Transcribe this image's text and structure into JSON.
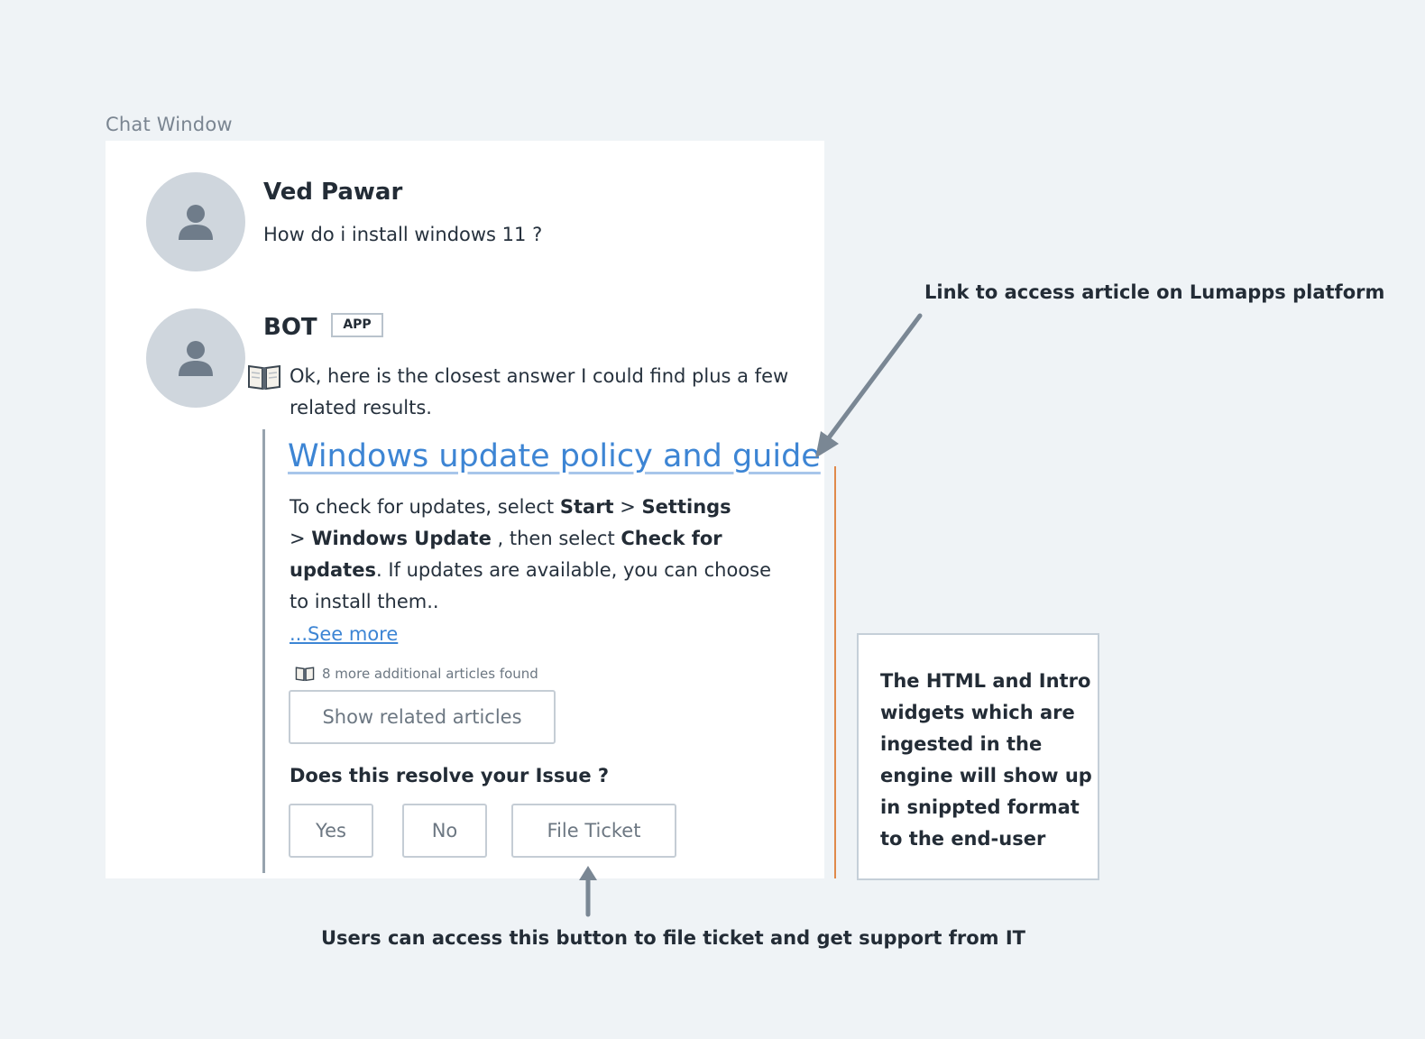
{
  "frame_label": "Chat Window",
  "user_message": {
    "sender": "Ved Pawar",
    "text": "How do i install windows 11 ?"
  },
  "bot_message": {
    "sender": "BOT",
    "badge": "APP",
    "intro": "Ok, here is the closest answer I could find plus a few related results.",
    "article": {
      "title": "Windows update policy and guide",
      "snippet": {
        "t1": "To check for updates, select ",
        "b1": "Start",
        "t2": "  > ",
        "b2": "Settings",
        "t3": " > ",
        "b3": "Windows Update",
        "t4": " , then select ",
        "b4": "Check for updates",
        "t5": ". If updates are available, you can choose to install them.."
      },
      "see_more": "...See more"
    },
    "more_articles": "8 more additional articles found",
    "show_related": "Show related articles",
    "question": "Does this resolve your Issue ?",
    "buttons": {
      "yes": "Yes",
      "no": "No",
      "file_ticket": "File Ticket"
    }
  },
  "annotations": {
    "link_note": "Link to access article on Lumapps platform",
    "ticket_note": "Users can access this button to file ticket and get support from IT",
    "widget_note": "The HTML and Intro widgets which are ingested in the engine will show up in snippted format to the end-user"
  },
  "colors": {
    "background": "#eff3f6",
    "link": "#3d85d4",
    "accent_line": "#e0894a",
    "arrow": "#7a8794"
  }
}
